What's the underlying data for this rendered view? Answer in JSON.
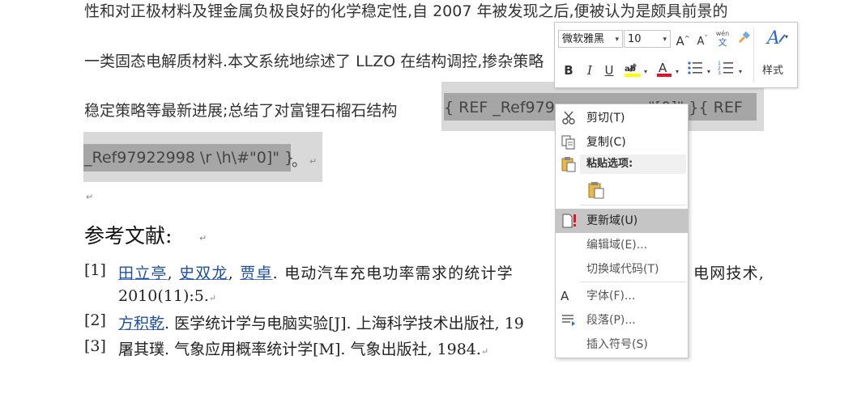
{
  "document": {
    "line1": "性和对正极材料及锂金属负极良好的化学稳定性,自 2007 年被发现之后,便被认为是颇具前景的",
    "line2": "一类固态电解质材料.本文系统地综述了 LLZO 在结构调控,掺杂策略",
    "line3_prefix": "稳定策略等最新进展;总结了对富锂石榴石结构",
    "field_code_part1_a": "{  REF  _Ref979",
    "field_code_part1_b": "\"[0]\"  }{  REF",
    "field_code_part2": "_Ref97922998 \\r \\h\\#\"0]\"  }",
    "field_tail": "。",
    "para_mark": "↵",
    "heading": "参考文献:",
    "references": [
      {
        "num": "[1]",
        "authors": [
          "田立亭",
          "史双龙",
          "贾卓"
        ],
        "text": ". 电动汽车充电功率需求的统计学",
        "text_tail": "电网技术,",
        "line2": "2010(11):5."
      },
      {
        "num": "[2]",
        "authors": [
          "方积乾"
        ],
        "text": ". 医学统计学与电脑实验[J]. 上海科学技术出版社, 19"
      },
      {
        "num": "[3]",
        "authors": [],
        "text": "屠其璞. 气象应用概率统计学[M]. 气象出版社, 1984."
      }
    ]
  },
  "mini_toolbar": {
    "font_name": "微软雅黑",
    "font_size": "10",
    "grow_font": "A^",
    "shrink_font": "Aˇ",
    "phonetic_top": "wén",
    "phonetic_bottom": "文",
    "bold": "B",
    "italic": "I",
    "underline": "U",
    "font_color": "A",
    "styles_label": "样式",
    "highlight_color": "#ffff00",
    "font_color_bar": "#e81123"
  },
  "context_menu": {
    "items": [
      {
        "label": "剪切(T)",
        "icon": "scissors-icon"
      },
      {
        "label": "复制(C)",
        "icon": "copy-icon"
      },
      {
        "label": "粘贴选项:",
        "icon": "paste-icon"
      },
      {
        "label": "更新域(U)",
        "icon": "update-field-icon"
      },
      {
        "label": "编辑域(E)..."
      },
      {
        "label": "切换域代码(T)"
      },
      {
        "label": "字体(F)...",
        "icon": "font-icon"
      },
      {
        "label": "段落(P)...",
        "icon": "paragraph-icon"
      },
      {
        "label": "插入符号(S)"
      }
    ]
  }
}
